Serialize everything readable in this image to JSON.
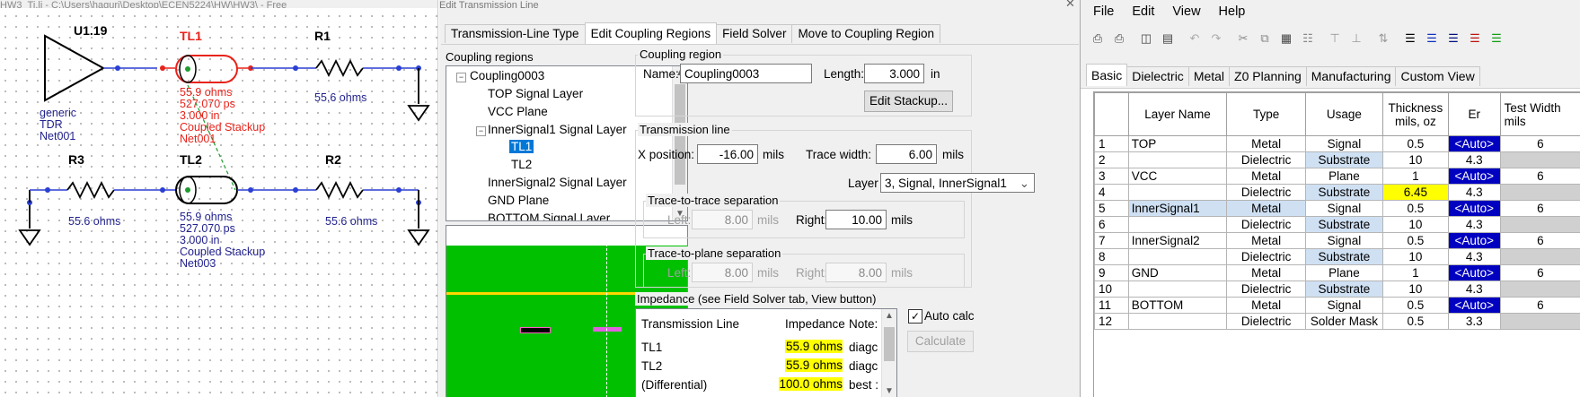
{
  "schematic": {
    "window_title": "HW3_Ti.li - C:\\Users\\haguri\\Desktop\\ECEN5224\\HW\\HW3\\ - Free",
    "driver": {
      "ref": "U1.19",
      "lines": [
        "generic",
        "TDR",
        "Net001"
      ]
    },
    "tl1": {
      "ref": "TL1",
      "lines": [
        "55.9 ohms",
        "527.070 ps",
        "3.000 in",
        "Coupled Stackup",
        "Net001"
      ]
    },
    "tl2": {
      "ref": "TL2",
      "lines": [
        "55.9 ohms",
        "527.070 ps",
        "3.000 in",
        "Coupled Stackup",
        "Net003"
      ]
    },
    "r1": {
      "ref": "R1",
      "value": "55.6 ohms"
    },
    "r2": {
      "ref": "R2",
      "value": "55.6 ohms"
    },
    "r3": {
      "ref": "R3",
      "value": "55.6 ohms"
    },
    "colors": {
      "selected": "#e8231b",
      "wire": "#2a3fd4",
      "label": "#23238e",
      "component": "#000000"
    }
  },
  "dialog": {
    "title": "Edit Transmission Line",
    "tabs": [
      "Transmission-Line Type",
      "Edit Coupling Regions",
      "Field Solver",
      "Move to Coupling Region"
    ],
    "active_tab": "Edit Coupling Regions",
    "coupling_regions": {
      "title": "Coupling regions",
      "nodes": [
        "Coupling0003",
        "TOP Signal Layer",
        "VCC Plane",
        "InnerSignal1 Signal Layer",
        "TL1",
        "TL2",
        "InnerSignal2 Signal Layer",
        "GND Plane",
        "BOTTOM Signal Layer"
      ],
      "selected": "TL1"
    },
    "coupling_region": {
      "title": "Coupling region",
      "name_label": "Name:",
      "name_value": "Coupling0003",
      "length_label": "Length:",
      "length_value": "3.000",
      "length_unit": "in",
      "edit_stackup": "Edit Stackup..."
    },
    "transmission_line": {
      "title": "Transmission line",
      "xpos_label": "X position:",
      "xpos_value": "-16.00",
      "xpos_unit": "mils",
      "width_label": "Trace width:",
      "width_value": "6.00",
      "width_unit": "mils",
      "layer_label": "Layer",
      "layer_value": "3, Signal, InnerSignal1",
      "t2t": {
        "title": "Trace-to-trace separation",
        "left_label": "Left:",
        "left_value": "8.00",
        "left_unit": "mils",
        "right_label": "Right:",
        "right_value": "10.00",
        "right_unit": "mils"
      },
      "t2p": {
        "title": "Trace-to-plane separation",
        "left_label": "Left:",
        "left_value": "8.00",
        "left_unit": "mils",
        "right_label": "Right:",
        "right_value": "8.00",
        "right_unit": "mils"
      }
    },
    "impedance": {
      "title": "Impedance (see Field Solver tab, View button)",
      "headers": [
        "Transmission Line",
        "Impedance",
        "Notes"
      ],
      "header_notes_visible": "Note:",
      "rows": [
        {
          "line": "TL1",
          "impedance": "55.9 ohms",
          "notes": "diagc"
        },
        {
          "line": "TL2",
          "impedance": "55.9 ohms",
          "notes": "diagc"
        },
        {
          "line": "(Differential)",
          "impedance": "100.0 ohms",
          "notes": "best :"
        }
      ],
      "auto_calc_label": "Auto calc",
      "auto_calc_checked": true,
      "calculate": "Calculate"
    }
  },
  "stackup": {
    "menu": [
      "File",
      "Edit",
      "View",
      "Help"
    ],
    "toolbar_icons": [
      "print-icon",
      "print-preview-icon",
      "columns-icon",
      "rows-icon",
      "undo-icon",
      "redo-icon",
      "cut-icon",
      "copy-icon",
      "paste-special-icon",
      "paste-icon",
      "insert-above-icon",
      "insert-below-icon",
      "sort-icon",
      "layer-color-icon",
      "blue-bars-icon",
      "navy-bars-icon",
      "red-bars-icon",
      "green-bars-icon"
    ],
    "tabs": [
      "Basic",
      "Dielectric",
      "Metal",
      "Z0 Planning",
      "Manufacturing",
      "Custom View"
    ],
    "active_tab": "Basic",
    "headers": [
      "",
      "Layer Name",
      "Type",
      "Usage",
      "Thickness mils, oz",
      "Er",
      "Test Width mils"
    ],
    "rows": [
      [
        "1",
        "TOP",
        "Metal",
        "Signal",
        "0.5",
        "<Auto>",
        "6"
      ],
      [
        "2",
        "",
        "Dielectric",
        "Substrate",
        "10",
        "4.3",
        ""
      ],
      [
        "3",
        "VCC",
        "Metal",
        "Plane",
        "1",
        "<Auto>",
        "6"
      ],
      [
        "4",
        "",
        "Dielectric",
        "Substrate",
        "6.45",
        "4.3",
        ""
      ],
      [
        "5",
        "InnerSignal1",
        "Metal",
        "Signal",
        "0.5",
        "<Auto>",
        "6"
      ],
      [
        "6",
        "",
        "Dielectric",
        "Substrate",
        "10",
        "4.3",
        ""
      ],
      [
        "7",
        "InnerSignal2",
        "Metal",
        "Signal",
        "0.5",
        "<Auto>",
        "6"
      ],
      [
        "8",
        "",
        "Dielectric",
        "Substrate",
        "10",
        "4.3",
        ""
      ],
      [
        "9",
        "GND",
        "Metal",
        "Plane",
        "1",
        "<Auto>",
        "6"
      ],
      [
        "10",
        "",
        "Dielectric",
        "Substrate",
        "10",
        "4.3",
        ""
      ],
      [
        "11",
        "BOTTOM",
        "Metal",
        "Signal",
        "0.5",
        "<Auto>",
        "6"
      ],
      [
        "12",
        "",
        "Dielectric",
        "Solder Mask",
        "0.5",
        "3.3",
        ""
      ]
    ]
  }
}
